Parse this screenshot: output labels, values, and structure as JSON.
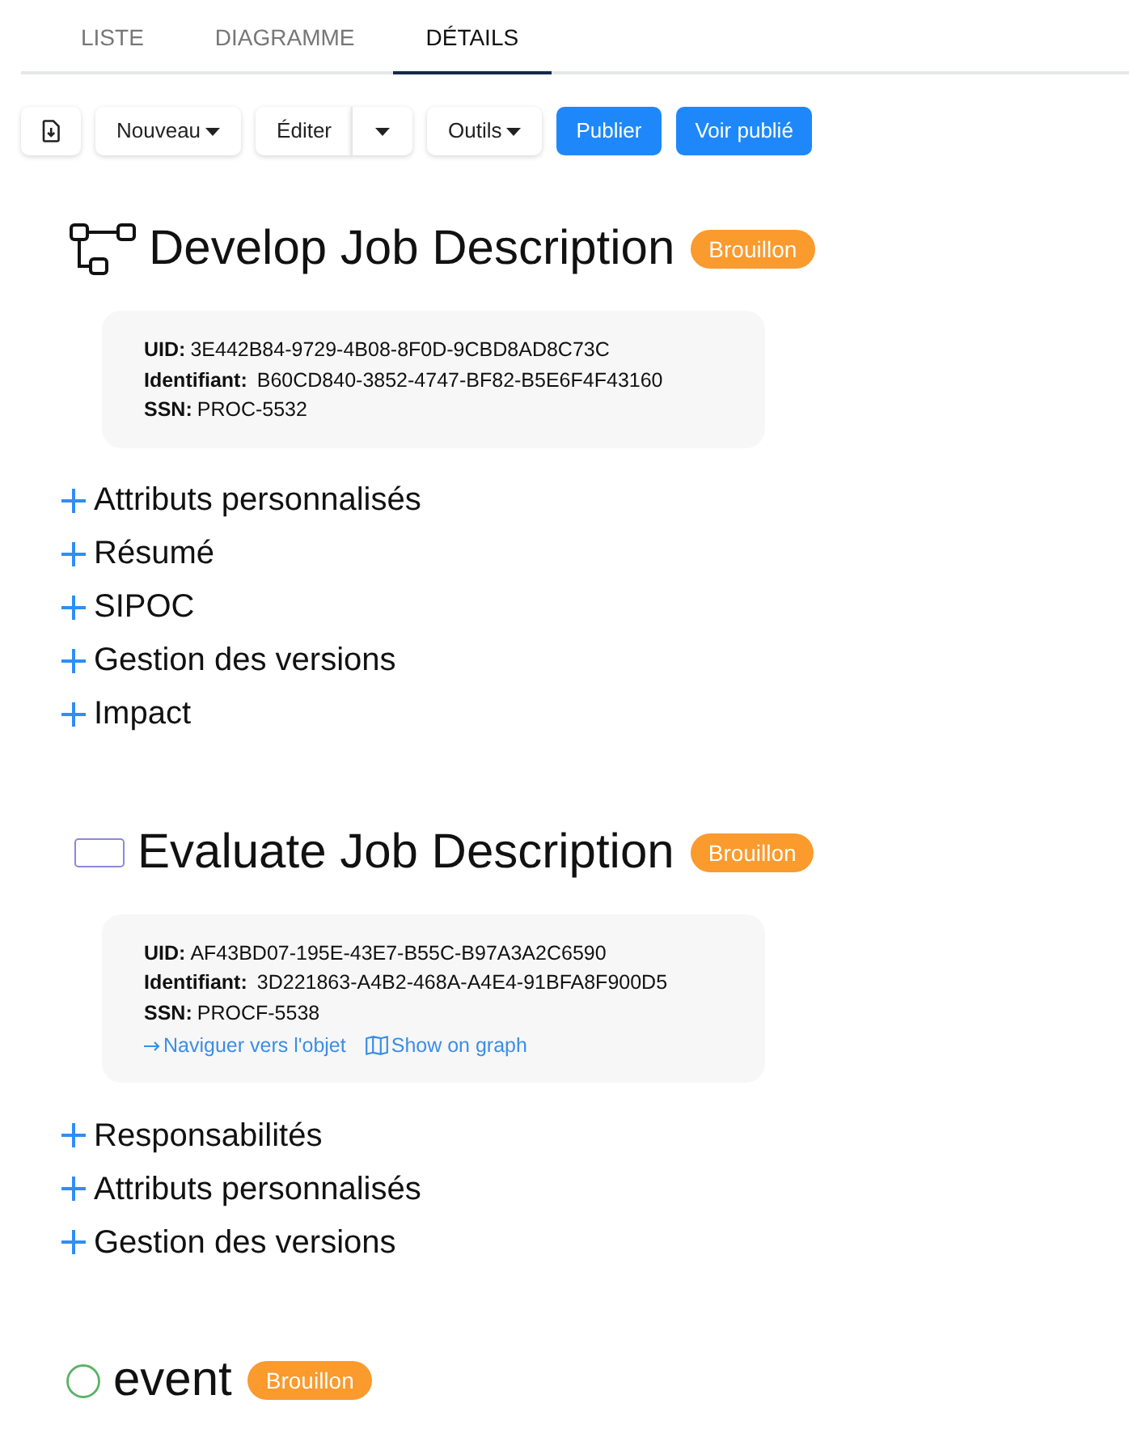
{
  "tabs": [
    {
      "label": "LISTE",
      "selected": false
    },
    {
      "label": "DIAGRAMME",
      "selected": false
    },
    {
      "label": "DÉTAILS",
      "selected": true
    }
  ],
  "toolbar": [
    {
      "kind": "icon"
    },
    {
      "kind": "dropdown",
      "label": "Nouveau"
    },
    {
      "kind": "split",
      "label": "Éditer"
    },
    {
      "kind": "dropdown",
      "label": "Outils"
    },
    {
      "kind": "primary",
      "label": "Publier"
    },
    {
      "kind": "primary",
      "label": "Voir publié"
    }
  ],
  "sections": [
    {
      "kind": "process",
      "title": "Develop Job Description",
      "status": "Brouillon",
      "info": [
        {
          "label": "UID:",
          "value": "3E442B84-9729-4B08-8F0D-9CBD8AD8C73C"
        },
        {
          "label": "Identifiant:",
          "value": "B60CD840-3852-4747-BF82-B5E6F4F43160"
        },
        {
          "label": "SSN:",
          "value": "PROC-5532"
        }
      ],
      "expanders": [
        {
          "label": "Attributs personnalisés",
          "expanded": false
        },
        {
          "label": "Résumé",
          "expanded": false
        },
        {
          "label": "SIPOC",
          "expanded": false
        },
        {
          "label": "Gestion des versions",
          "expanded": false
        },
        {
          "label": "Impact",
          "expanded": false
        }
      ]
    },
    {
      "kind": "activity",
      "title": "Evaluate Job Description",
      "status": "Brouillon",
      "info": [
        {
          "label": "UID:",
          "value": "AF43BD07-195E-43E7-B55C-B97A3A2C6590"
        },
        {
          "label": "Identifiant:",
          "value": "3D221863-A4B2-468A-A4E4-91BFA8F900D5"
        },
        {
          "label": "SSN:",
          "value": "PROCF-5538"
        }
      ],
      "links": [
        {
          "kind": "navigate",
          "label": "Naviguer vers l'objet"
        },
        {
          "kind": "graph",
          "label": "Show on graph"
        }
      ],
      "expanders": [
        {
          "label": "Responsabilités",
          "expanded": false
        },
        {
          "label": "Attributs personnalisés",
          "expanded": false
        },
        {
          "label": "Gestion des versions",
          "expanded": false
        }
      ]
    },
    {
      "kind": "event",
      "title": "event",
      "status": "Brouillon"
    }
  ]
}
